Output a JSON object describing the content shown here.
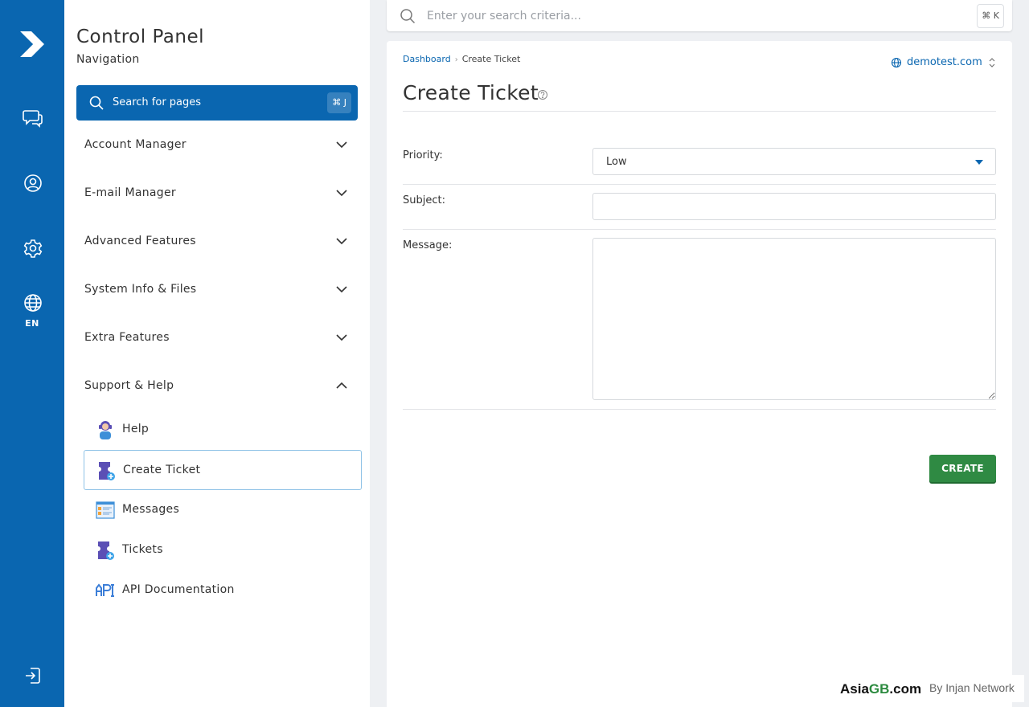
{
  "rail": {
    "language": "EN",
    "icons": [
      "logo-icon",
      "chat-icon",
      "user-icon",
      "gear-icon",
      "globe-icon",
      "logout-icon"
    ]
  },
  "nav": {
    "title": "Control Panel",
    "subtitle": "Navigation",
    "search": {
      "label": "Search for pages",
      "shortcut": "⌘ J"
    },
    "sections": [
      {
        "label": "Account Manager",
        "expanded": false
      },
      {
        "label": "E-mail Manager",
        "expanded": false
      },
      {
        "label": "Advanced Features",
        "expanded": false
      },
      {
        "label": "System Info & Files",
        "expanded": false
      },
      {
        "label": "Extra Features",
        "expanded": false
      },
      {
        "label": "Support & Help",
        "expanded": true
      }
    ],
    "support_items": [
      {
        "label": "Help",
        "icon": "help-agent-icon",
        "active": false
      },
      {
        "label": "Create Ticket",
        "icon": "create-ticket-icon",
        "active": true
      },
      {
        "label": "Messages",
        "icon": "messages-icon",
        "active": false
      },
      {
        "label": "Tickets",
        "icon": "tickets-icon",
        "active": false
      },
      {
        "label": "API Documentation",
        "icon": "api-icon",
        "active": false
      }
    ]
  },
  "topbar": {
    "search_placeholder": "Enter your search criteria...",
    "shortcut": "⌘ K"
  },
  "main": {
    "breadcrumb": {
      "root": "Dashboard",
      "current": "Create Ticket"
    },
    "domain": "demotest.com",
    "heading": "Create Ticket",
    "form": {
      "priority_label": "Priority:",
      "priority_value": "Low",
      "subject_label": "Subject:",
      "subject_value": "",
      "message_label": "Message:",
      "message_value": ""
    },
    "create_button": "CREATE"
  },
  "brand": {
    "name_part1": "Asia",
    "name_part2": "GB",
    "name_part3": ".com",
    "tagline": "By Injan Network"
  },
  "colors": {
    "primary": "#0a66b0",
    "create_button": "#2f8a43",
    "active_border": "#8ec2e6"
  }
}
